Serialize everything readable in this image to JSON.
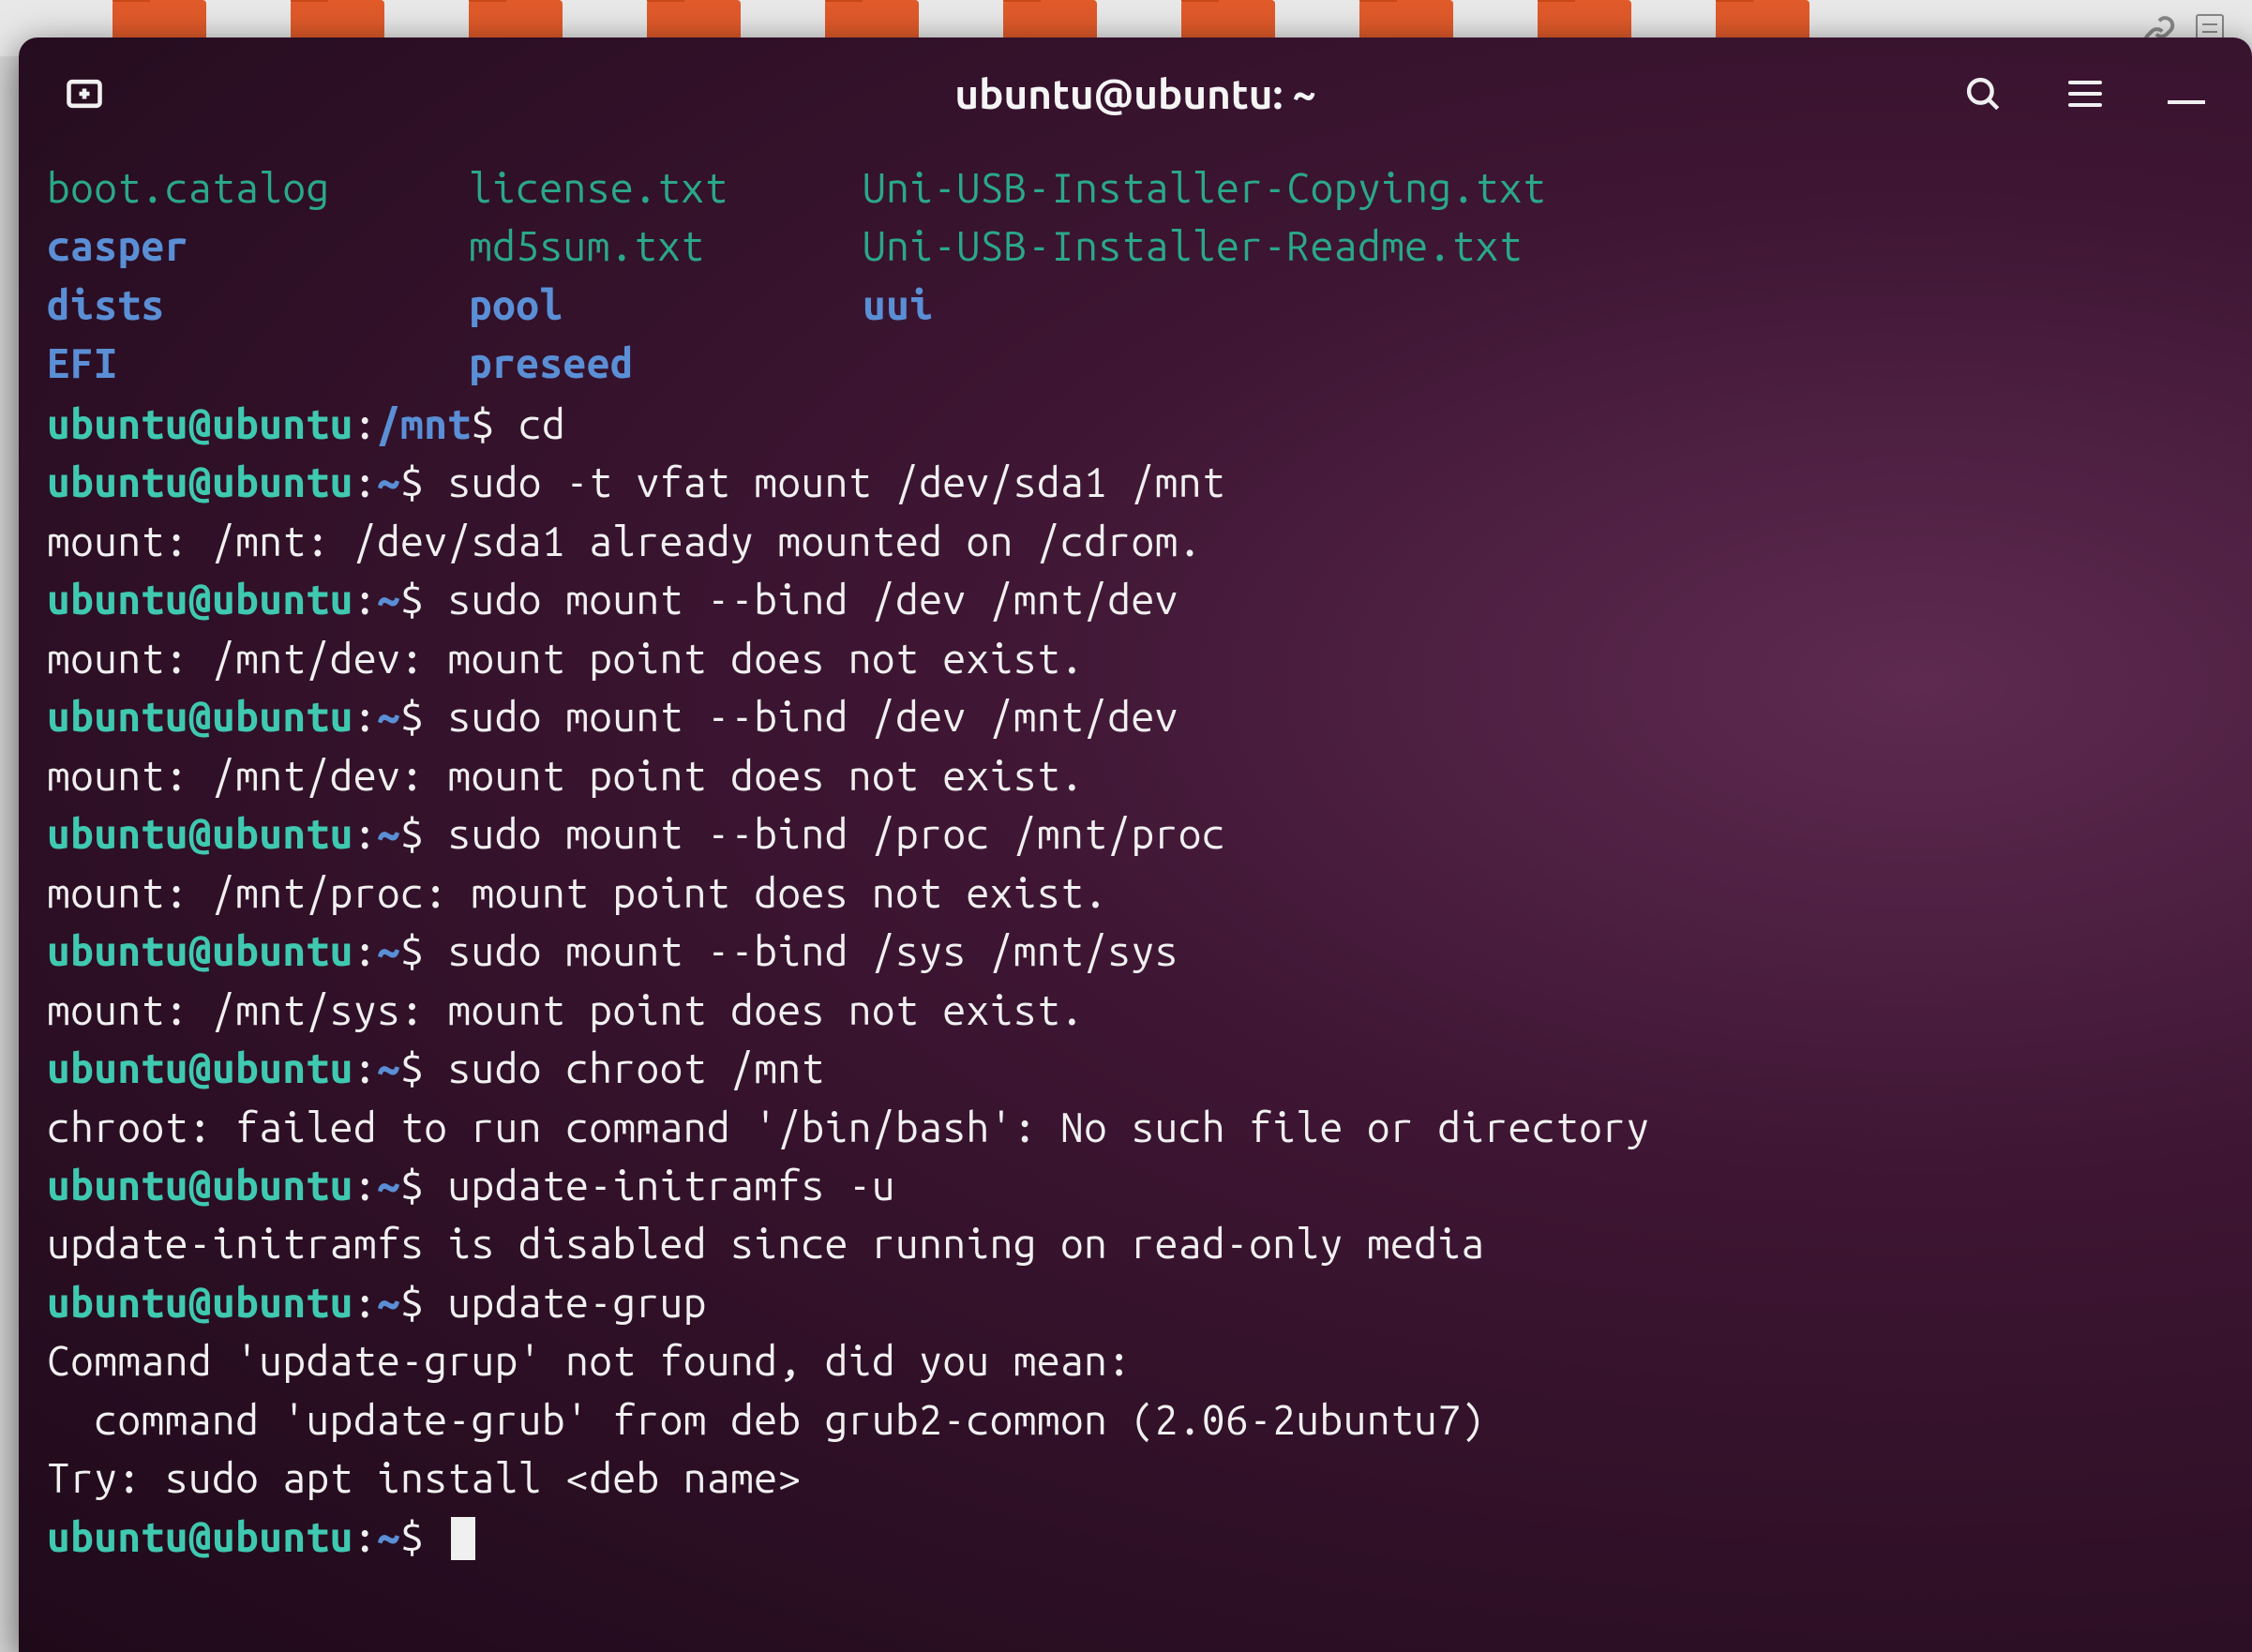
{
  "window": {
    "title": "ubuntu@ubuntu: ~"
  },
  "ls": {
    "r1c1": "boot.catalog",
    "r1c2": "license.txt",
    "r1c3": "Uni-USB-Installer-Copying.txt",
    "r2c1": "casper",
    "r2c2": "md5sum.txt",
    "r2c3": "Uni-USB-Installer-Readme.txt",
    "r3c1": "dists",
    "r3c2": "pool",
    "r3c3": "uui",
    "r4c1": "EFI",
    "r4c2": "preseed"
  },
  "lines": [
    {
      "type": "prompt",
      "user": "ubuntu@ubuntu",
      "path": "/mnt",
      "cmd": "cd"
    },
    {
      "type": "prompt",
      "user": "ubuntu@ubuntu",
      "path": "~",
      "cmd": "sudo -t vfat mount /dev/sda1 /mnt"
    },
    {
      "type": "out",
      "text": "mount: /mnt: /dev/sda1 already mounted on /cdrom."
    },
    {
      "type": "prompt",
      "user": "ubuntu@ubuntu",
      "path": "~",
      "cmd": "sudo mount --bind /dev /mnt/dev"
    },
    {
      "type": "out",
      "text": "mount: /mnt/dev: mount point does not exist."
    },
    {
      "type": "prompt",
      "user": "ubuntu@ubuntu",
      "path": "~",
      "cmd": "sudo mount --bind /dev /mnt/dev"
    },
    {
      "type": "out",
      "text": "mount: /mnt/dev: mount point does not exist."
    },
    {
      "type": "prompt",
      "user": "ubuntu@ubuntu",
      "path": "~",
      "cmd": "sudo mount --bind /proc /mnt/proc"
    },
    {
      "type": "out",
      "text": "mount: /mnt/proc: mount point does not exist."
    },
    {
      "type": "prompt",
      "user": "ubuntu@ubuntu",
      "path": "~",
      "cmd": "sudo mount --bind /sys /mnt/sys"
    },
    {
      "type": "out",
      "text": "mount: /mnt/sys: mount point does not exist."
    },
    {
      "type": "prompt",
      "user": "ubuntu@ubuntu",
      "path": "~",
      "cmd": "sudo chroot /mnt"
    },
    {
      "type": "out",
      "text": "chroot: failed to run command '/bin/bash': No such file or directory"
    },
    {
      "type": "prompt",
      "user": "ubuntu@ubuntu",
      "path": "~",
      "cmd": "update-initramfs -u"
    },
    {
      "type": "out",
      "text": "update-initramfs is disabled since running on read-only media"
    },
    {
      "type": "prompt",
      "user": "ubuntu@ubuntu",
      "path": "~",
      "cmd": "update-grup"
    },
    {
      "type": "out",
      "text": "Command 'update-grup' not found, did you mean:"
    },
    {
      "type": "out",
      "text": "  command 'update-grub' from deb grub2-common (2.06-2ubuntu7)"
    },
    {
      "type": "out",
      "text": "Try: sudo apt install <deb name>"
    },
    {
      "type": "prompt",
      "user": "ubuntu@ubuntu",
      "path": "~",
      "cmd": "",
      "cursor": true
    }
  ]
}
